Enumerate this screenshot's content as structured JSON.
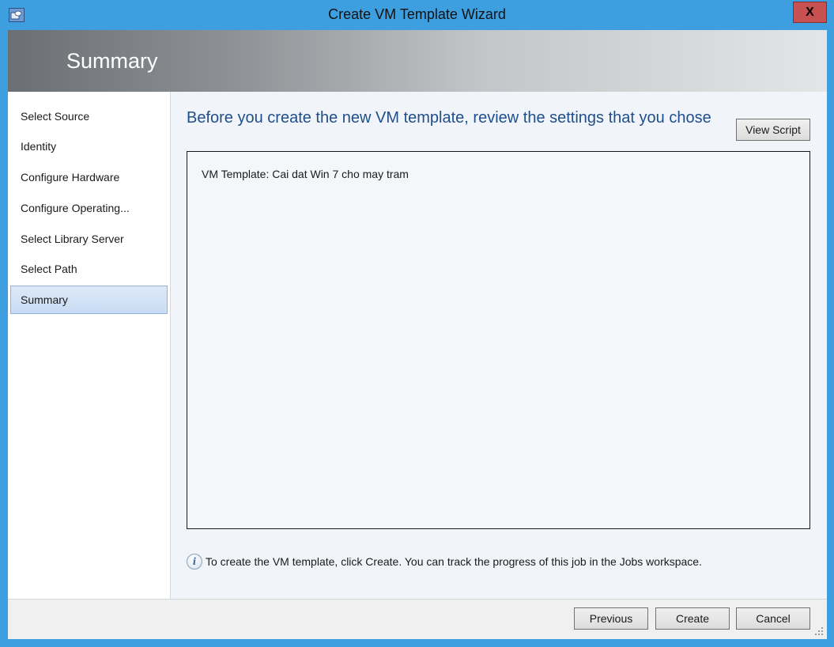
{
  "window": {
    "title": "Create VM Template Wizard",
    "close_label": "X",
    "accent_color": "#3e9fe0"
  },
  "header": {
    "title": "Summary"
  },
  "nav": {
    "items": [
      {
        "label": "Select Source",
        "selected": false
      },
      {
        "label": "Identity",
        "selected": false
      },
      {
        "label": "Configure Hardware",
        "selected": false
      },
      {
        "label": "Configure Operating...",
        "selected": false
      },
      {
        "label": "Select Library Server",
        "selected": false
      },
      {
        "label": "Select Path",
        "selected": false
      },
      {
        "label": "Summary",
        "selected": true
      }
    ]
  },
  "main": {
    "heading": "Before you create the new VM template, review the settings that you chose",
    "view_script_label": "View Script",
    "summary": {
      "key": "VM Template:",
      "value": "Cai dat Win 7 cho may tram"
    },
    "info": {
      "icon": "info-icon",
      "text": "To create the VM template, click Create. You can track the progress of this job in the Jobs workspace."
    }
  },
  "footer": {
    "previous_label": "Previous",
    "create_label": "Create",
    "cancel_label": "Cancel"
  }
}
